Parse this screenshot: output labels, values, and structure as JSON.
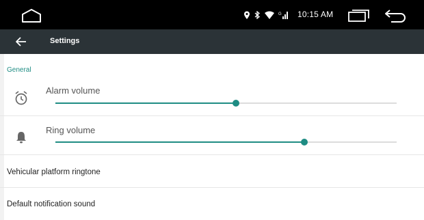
{
  "status_bar": {
    "time": "10:15 AM",
    "icons": [
      "home-icon",
      "location-icon",
      "bluetooth-icon",
      "wifi-icon",
      "signal-icon",
      "recents-icon",
      "back-icon"
    ]
  },
  "action_bar": {
    "back_icon": "arrow-left-icon",
    "title": "Settings"
  },
  "section": {
    "header": "General"
  },
  "alarm": {
    "label": "Alarm volume",
    "icon": "alarm-clock-icon",
    "level": 0.53
  },
  "ring": {
    "label": "Ring volume",
    "icon": "bell-icon",
    "level": 0.73
  },
  "items": [
    {
      "label": "Vehicular platform ringtone"
    },
    {
      "label": "Default notification sound"
    }
  ],
  "colors": {
    "accent": "#1e8c83",
    "status_bar": "#000000",
    "action_bar": "#2b3337"
  }
}
